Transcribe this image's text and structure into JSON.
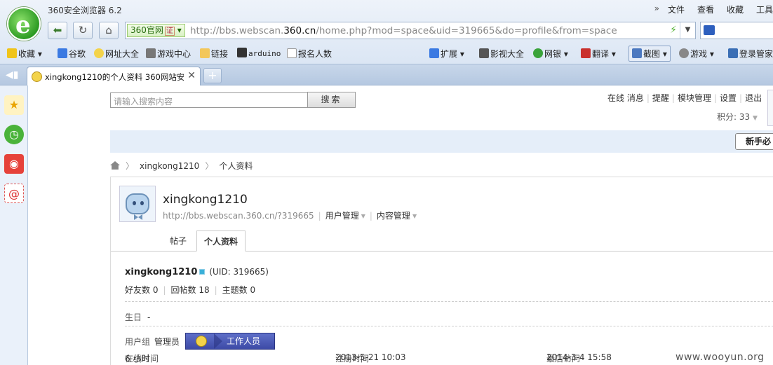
{
  "browser": {
    "app_title": "360安全浏览器 6.2",
    "top_menu": [
      "文件",
      "查看",
      "收藏",
      "工具"
    ],
    "address_badge": "360官网",
    "address_badge_cert": "证",
    "url_prefix": "http://bbs.webscan.",
    "url_domain": "360.cn",
    "url_suffix": "/home.php?mod=space&uid=319665&do=profile&from=space",
    "bookmarks_left": [
      "收藏",
      "谷歌",
      "网址大全",
      "游戏中心",
      "链接",
      "arduino",
      "报名人数"
    ],
    "bookmarks_right": [
      "扩展",
      "影视大全",
      "网银",
      "翻译",
      "截图",
      "游戏",
      "登录管家"
    ],
    "tab_title": "xingkong1210的个人资料 360网站安全",
    "newtab_symbol": "+",
    "close_symbol": "✕"
  },
  "forum": {
    "search_placeholder": "请输入搜索内容",
    "search_button": "搜索",
    "user_nav": [
      "在线",
      "消息",
      "提醒",
      "模块管理",
      "设置",
      "退出"
    ],
    "credit_label": "积分: 33",
    "newbie_button": "新手必",
    "breadcrumb": [
      "xingkong1210",
      "个人资料"
    ]
  },
  "profile": {
    "username": "xingkong1210",
    "space_url": "http://bbs.webscan.360.cn/?319665",
    "user_manage": "用户管理",
    "content_manage": "内容管理",
    "tabs": [
      {
        "label": "帖子",
        "active": false
      },
      {
        "label": "个人资料",
        "active": true
      }
    ],
    "info_name": "xingkong1210",
    "uid_text": "(UID: 319665)",
    "stats": [
      "好友数 0",
      "回帖数 18",
      "主题数 0"
    ],
    "birthday_label": "生日",
    "birthday_value": "-",
    "group_label": "用户组",
    "group_value": "管理员",
    "group_badge": "工作人员",
    "online_label": "在线时间",
    "online_value": "6 小时",
    "reg_label": "注册时间",
    "reg_value": "2013-5-21 10:03",
    "last_label": "最后访问",
    "last_value": "2014-3-4 15:58"
  },
  "watermark": "www.wooyun.org"
}
